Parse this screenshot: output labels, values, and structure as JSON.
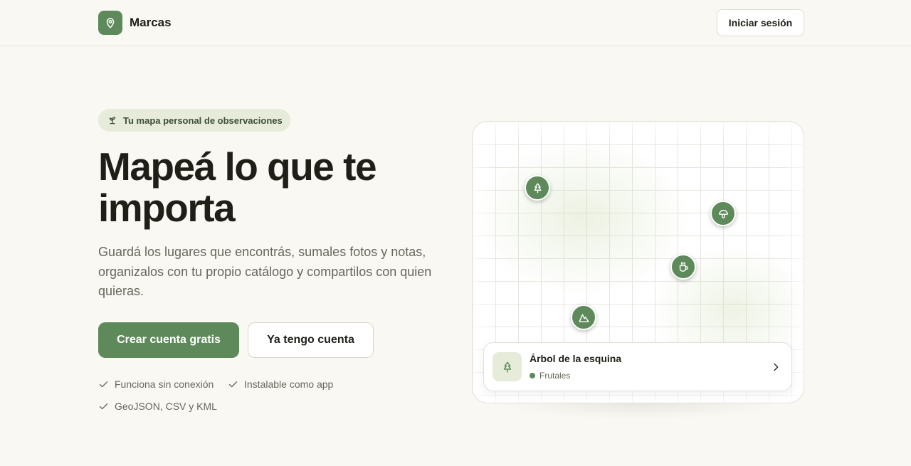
{
  "header": {
    "brand_name": "Marcas",
    "brand_icon": "map-pin-icon",
    "login_label": "Iniciar sesión"
  },
  "hero": {
    "badge_icon": "sprout-icon",
    "badge_text": "Tu mapa personal de observaciones",
    "title_line1": "Mapeá lo que te",
    "title_line2": "importa",
    "subtitle": "Guardá los lugares que encontrás, sumales fotos y notas, organizalos con tu propio catálogo y compartilos con quien quieras.",
    "primary_cta": "Crear cuenta gratis",
    "secondary_cta": "Ya tengo cuenta",
    "features": [
      "Funciona sin conexión",
      "Instalable como app",
      "GeoJSON, CSV y KML"
    ]
  },
  "map": {
    "pins": [
      "tree-icon",
      "mushroom-icon",
      "coffee-icon",
      "mountain-icon"
    ],
    "selected_place": {
      "title": "Árbol de la esquina",
      "category": "Frutales",
      "icon": "tree-icon"
    }
  },
  "colors": {
    "accent": "#5e8a5b",
    "background": "#f9f8f3",
    "badge_bg": "#e6ecd9"
  }
}
